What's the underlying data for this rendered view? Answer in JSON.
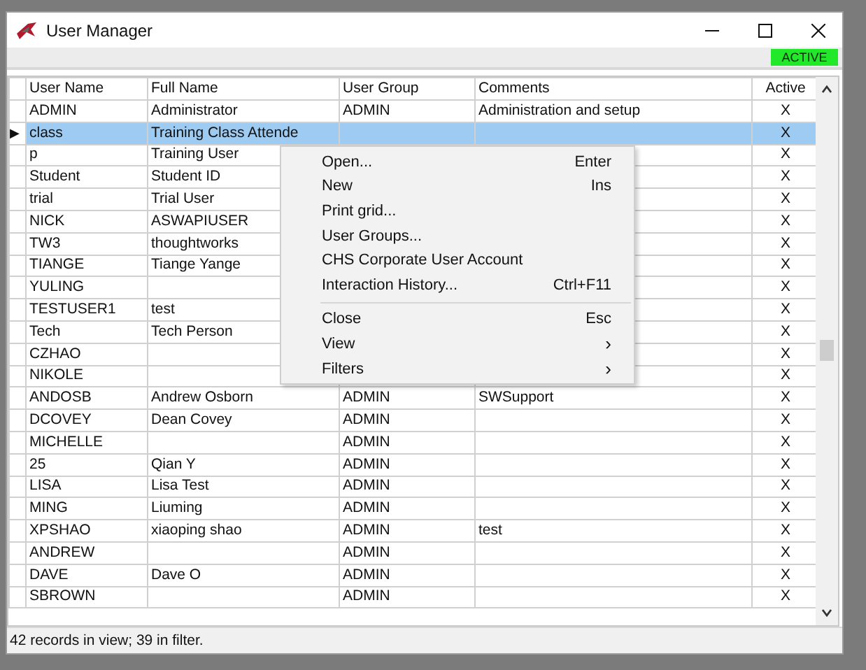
{
  "window": {
    "title": "User Manager"
  },
  "status_badge": "ACTIVE",
  "table": {
    "columns": [
      "User Name",
      "Full Name",
      "User Group",
      "Comments",
      "Active"
    ],
    "rows": [
      {
        "selected": false,
        "user": "ADMIN",
        "full": "Administrator",
        "group": "ADMIN",
        "comments": "Administration and setup",
        "active": "X"
      },
      {
        "selected": true,
        "marker": "▶",
        "user": "class",
        "full": "Training Class Attende",
        "active": "X"
      },
      {
        "selected": false,
        "user": "p",
        "full": "Training User",
        "active": "X"
      },
      {
        "selected": false,
        "user": "Student",
        "full": "Student ID",
        "active": "X"
      },
      {
        "selected": false,
        "user": "trial",
        "full": "Trial User",
        "active": "X"
      },
      {
        "selected": false,
        "user": "NICK",
        "full": "ASWAPIUSER",
        "active": "X"
      },
      {
        "selected": false,
        "user": "TW3",
        "full": "thoughtworks",
        "active": "X"
      },
      {
        "selected": false,
        "user": "TIANGE",
        "full": "Tiange Yange",
        "active": "X"
      },
      {
        "selected": false,
        "user": "YULING",
        "active": "X"
      },
      {
        "selected": false,
        "user": "TESTUSER1",
        "full": "test",
        "active": "X"
      },
      {
        "selected": false,
        "user": "Tech",
        "full": "Tech Person",
        "active": "X"
      },
      {
        "selected": false,
        "user": "CZHAO",
        "active": "X"
      },
      {
        "selected": false,
        "user": "NIKOLE",
        "active": "X"
      },
      {
        "selected": false,
        "user": "ANDOSB",
        "full": "Andrew Osborn",
        "group": "ADMIN",
        "comments": "SWSupport",
        "active": "X"
      },
      {
        "selected": false,
        "user": "DCOVEY",
        "full": "Dean Covey",
        "group": "ADMIN",
        "active": "X"
      },
      {
        "selected": false,
        "user": "MICHELLE",
        "group": "ADMIN",
        "active": "X"
      },
      {
        "selected": false,
        "user": "25",
        "full": "Qian Y",
        "group": "ADMIN",
        "active": "X"
      },
      {
        "selected": false,
        "user": "LISA",
        "full": "Lisa Test",
        "group": "ADMIN",
        "active": "X"
      },
      {
        "selected": false,
        "user": "MING",
        "full": "Liuming",
        "group": "ADMIN",
        "active": "X"
      },
      {
        "selected": false,
        "user": "XPSHAO",
        "full": "xiaoping shao",
        "group": "ADMIN",
        "comments": "test",
        "active": "X"
      },
      {
        "selected": false,
        "user": "ANDREW",
        "group": "ADMIN",
        "active": "X"
      },
      {
        "selected": false,
        "user": "DAVE",
        "full": "Dave O",
        "group": "ADMIN",
        "active": "X"
      },
      {
        "selected": false,
        "user": "SBROWN",
        "group": "ADMIN",
        "active": "X"
      }
    ]
  },
  "context_menu": [
    {
      "kind": "item",
      "label": "Open...",
      "shortcut": "Enter"
    },
    {
      "kind": "item",
      "label": "New",
      "shortcut": "Ins"
    },
    {
      "kind": "item",
      "label": "Print grid..."
    },
    {
      "kind": "item",
      "label": "User Groups..."
    },
    {
      "kind": "item",
      "label": "CHS Corporate User Account"
    },
    {
      "kind": "item",
      "label": "Interaction History...",
      "shortcut": "Ctrl+F11"
    },
    {
      "kind": "separator"
    },
    {
      "kind": "item",
      "label": "Close",
      "shortcut": "Esc"
    },
    {
      "kind": "item",
      "label": "View",
      "arrow": "›"
    },
    {
      "kind": "item",
      "label": "Filters",
      "arrow": "›"
    }
  ],
  "status_bar": "42 records in view; 39 in filter."
}
